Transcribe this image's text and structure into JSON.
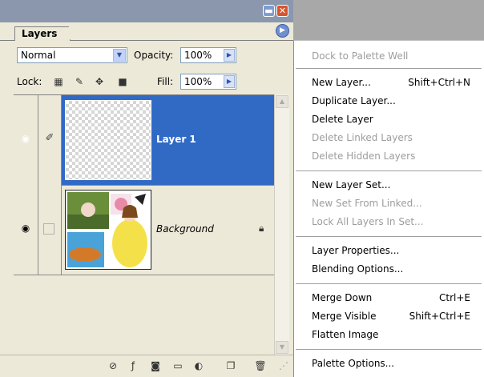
{
  "palette": {
    "tab_label": "Layers",
    "blend_mode": "Normal",
    "opacity_label": "Opacity:",
    "opacity_value": "100%",
    "lock_label": "Lock:",
    "fill_label": "Fill:",
    "fill_value": "100%"
  },
  "layers": [
    {
      "name": "Layer 1",
      "selected": true,
      "visible": true
    },
    {
      "name": "Background",
      "selected": false,
      "visible": true,
      "locked": true
    }
  ],
  "menu": {
    "dock": "Dock to Palette Well",
    "new_layer": "New Layer...",
    "new_layer_shortcut": "Shift+Ctrl+N",
    "duplicate_layer": "Duplicate Layer...",
    "delete_layer": "Delete Layer",
    "delete_linked": "Delete Linked Layers",
    "delete_hidden": "Delete Hidden Layers",
    "new_layer_set": "New Layer Set...",
    "new_set_from_linked": "New Set From Linked...",
    "lock_all_in_set": "Lock All Layers In Set...",
    "layer_properties": "Layer Properties...",
    "blending_options": "Blending Options...",
    "merge_down": "Merge Down",
    "merge_down_shortcut": "Ctrl+E",
    "merge_visible": "Merge Visible",
    "merge_visible_shortcut": "Shift+Ctrl+E",
    "flatten_image": "Flatten Image",
    "palette_options": "Palette Options..."
  },
  "colors": {
    "selection": "#316ac5",
    "titlebar": "#8b97ad",
    "disabled_text": "#9d9d9d"
  }
}
